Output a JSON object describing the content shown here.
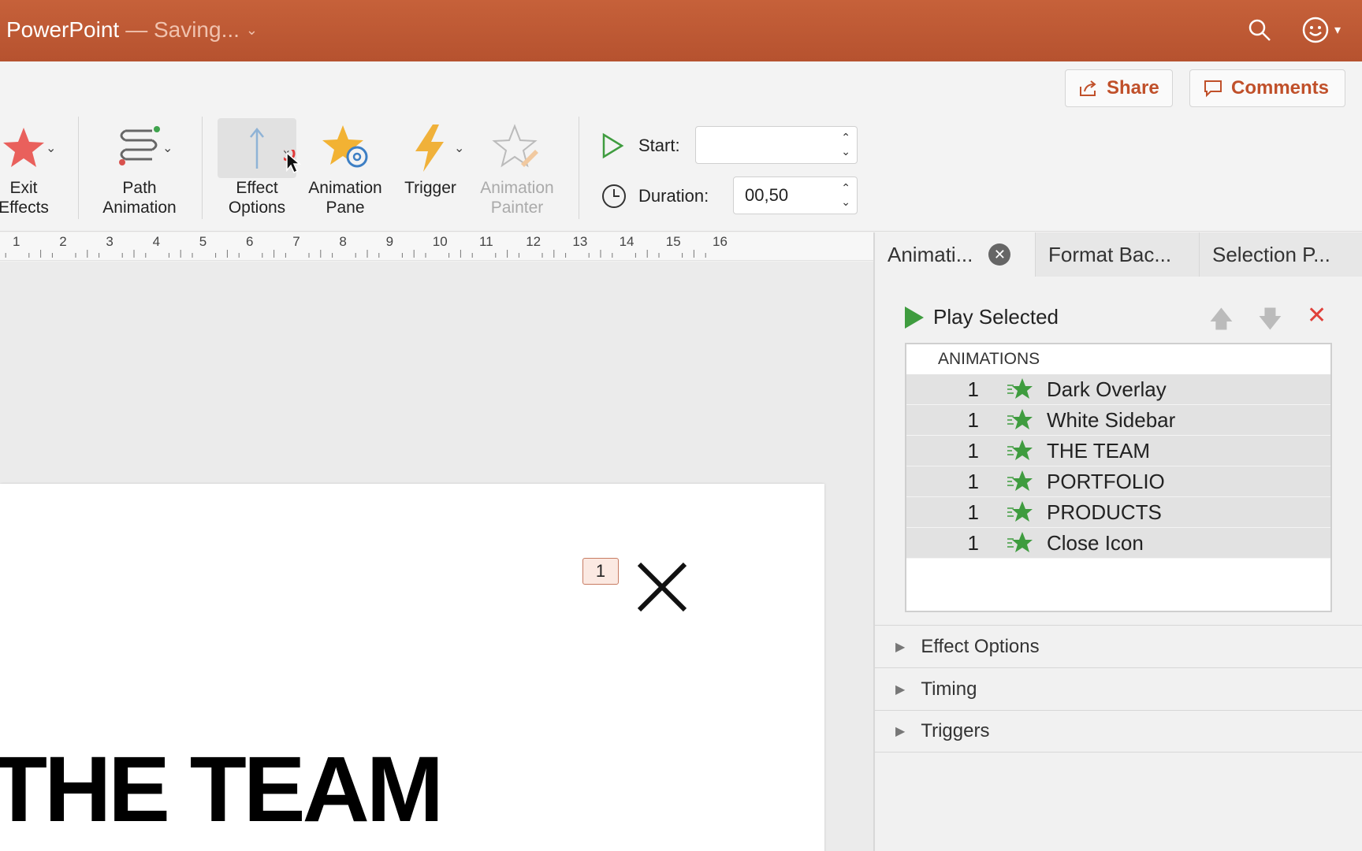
{
  "titlebar": {
    "app": "PowerPoint",
    "status": "— Saving...",
    "search_icon": "search-icon",
    "account_icon": "smiley-icon"
  },
  "header": {
    "share_label": "Share",
    "comments_label": "Comments"
  },
  "ribbon": {
    "exit_effects": "Exit\nEffects",
    "path_animation": "Path\nAnimation",
    "effect_options": "Effect\nOptions",
    "animation_pane": "Animation\nPane",
    "trigger": "Trigger",
    "animation_painter": "Animation\nPainter",
    "start_label": "Start:",
    "start_value": "",
    "duration_label": "Duration:",
    "duration_value": "00,50"
  },
  "ruler": {
    "ticks": [
      "1",
      "2",
      "3",
      "4",
      "5",
      "6",
      "7",
      "8",
      "9",
      "10",
      "11",
      "12",
      "13",
      "14",
      "15",
      "16"
    ]
  },
  "slide": {
    "anim_tag": "1",
    "heading": "THE TEAM"
  },
  "pane": {
    "tabs": [
      {
        "label": "Animati..."
      },
      {
        "label": "Format Bac..."
      },
      {
        "label": "Selection P..."
      }
    ],
    "play_selected": "Play Selected",
    "list_header": "ANIMATIONS",
    "animations": [
      {
        "num": "1",
        "label": "Dark Overlay"
      },
      {
        "num": "1",
        "label": "White Sidebar"
      },
      {
        "num": "1",
        "label": "THE TEAM"
      },
      {
        "num": "1",
        "label": "PORTFOLIO"
      },
      {
        "num": "1",
        "label": "PRODUCTS"
      },
      {
        "num": "1",
        "label": "Close Icon"
      }
    ],
    "sections": [
      {
        "label": "Effect Options"
      },
      {
        "label": "Timing"
      },
      {
        "label": "Triggers"
      }
    ]
  },
  "colors": {
    "titlebar": "#c0592f",
    "accent": "#c0502a",
    "star_green": "#3f9c3f"
  }
}
